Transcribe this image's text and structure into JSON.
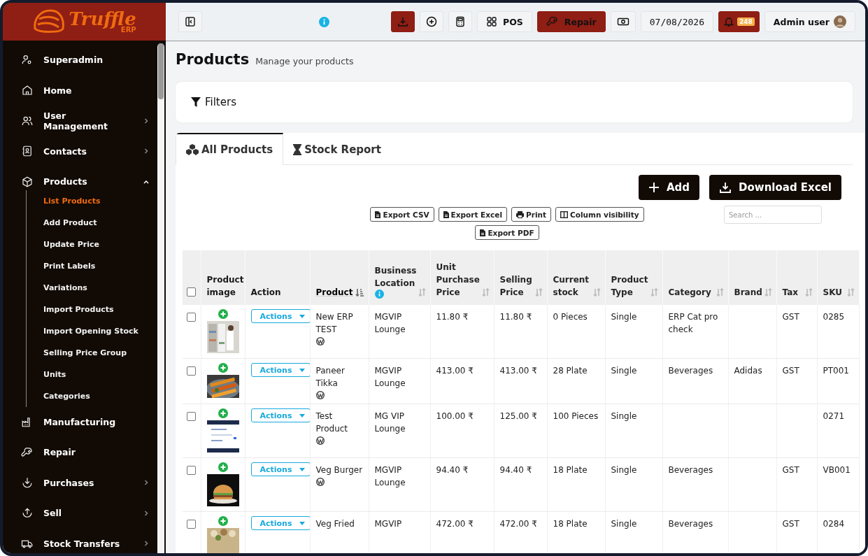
{
  "brand": {
    "name": "Truffle",
    "suffix": "ERP"
  },
  "header": {
    "pos": "POS",
    "repair": "Repair",
    "date": "07/08/2026",
    "notifications": "248",
    "user": "Admin user"
  },
  "sidebar": {
    "items": [
      {
        "label": "Superadmin",
        "expandable": false
      },
      {
        "label": "Home",
        "expandable": false
      },
      {
        "label": "User Management",
        "expandable": true,
        "expanded": false
      },
      {
        "label": "Contacts",
        "expandable": true,
        "expanded": false
      },
      {
        "label": "Products",
        "expandable": true,
        "expanded": true,
        "children": [
          {
            "label": "List Products",
            "selected": true
          },
          {
            "label": "Add Product",
            "selected": false
          },
          {
            "label": "Update Price",
            "selected": false
          },
          {
            "label": "Print Labels",
            "selected": false
          },
          {
            "label": "Variations",
            "selected": false
          },
          {
            "label": "Import Products",
            "selected": false
          },
          {
            "label": "Import Opening Stock",
            "selected": false
          },
          {
            "label": "Selling Price Group",
            "selected": false
          },
          {
            "label": "Units",
            "selected": false
          },
          {
            "label": "Categories",
            "selected": false
          }
        ]
      },
      {
        "label": "Manufacturing",
        "expandable": false
      },
      {
        "label": "Repair",
        "expandable": false
      },
      {
        "label": "Purchases",
        "expandable": true,
        "expanded": false
      },
      {
        "label": "Sell",
        "expandable": true,
        "expanded": false
      },
      {
        "label": "Stock Transfers",
        "expandable": true,
        "expanded": false
      }
    ]
  },
  "page": {
    "title": "Products",
    "subtitle": "Manage your products"
  },
  "filters": {
    "label": "Filters"
  },
  "tabs": [
    {
      "label": "All Products",
      "selected": true
    },
    {
      "label": "Stock Report",
      "selected": false
    }
  ],
  "actions": {
    "add": "Add",
    "download": "Download Excel"
  },
  "export_buttons": [
    "Export CSV",
    "Export Excel",
    "Print",
    "Column visibility",
    "Export PDF"
  ],
  "search": {
    "placeholder": "Search ..."
  },
  "table": {
    "columns": [
      {
        "kind": "check",
        "checked": false
      },
      {
        "kind": "text",
        "label": "Product image",
        "sortable": false,
        "info": false
      },
      {
        "kind": "text",
        "label": "Action",
        "sortable": false,
        "info": false
      },
      {
        "kind": "text",
        "label": "Product",
        "sortable": true,
        "sorted": true,
        "info": false
      },
      {
        "kind": "text",
        "label": "Business Location",
        "sortable": true,
        "sorted": false,
        "info": true
      },
      {
        "kind": "text",
        "label": "Unit Purchase Price",
        "sortable": true,
        "sorted": false,
        "info": false
      },
      {
        "kind": "text",
        "label": "Selling Price",
        "sortable": true,
        "sorted": false,
        "info": false
      },
      {
        "kind": "text",
        "label": "Current stock",
        "sortable": true,
        "sorted": false,
        "info": false
      },
      {
        "kind": "text",
        "label": "Product Type",
        "sortable": true,
        "sorted": false,
        "info": false
      },
      {
        "kind": "text",
        "label": "Category",
        "sortable": true,
        "sorted": false,
        "info": false
      },
      {
        "kind": "text",
        "label": "Brand",
        "sortable": true,
        "sorted": false,
        "info": false
      },
      {
        "kind": "text",
        "label": "Tax",
        "sortable": true,
        "sorted": false,
        "info": false
      },
      {
        "kind": "text",
        "label": "SKU",
        "sortable": true,
        "sorted": false,
        "info": false
      }
    ],
    "rows": [
      {
        "checked": false,
        "synced": true,
        "cells": [
          "",
          "",
          "Actions",
          "New ERP TEST",
          "MGVIP Lounge",
          "11.80 ₹",
          "11.80 ₹",
          "0 Pieces",
          "Single",
          "ERP Cat pro check",
          "",
          "GST",
          "0285"
        ]
      },
      {
        "checked": false,
        "synced": true,
        "cells": [
          "",
          "",
          "Actions",
          "Paneer Tikka",
          "MGVIP Lounge",
          "413.00 ₹",
          "413.00 ₹",
          "28 Plate",
          "Single",
          "Beverages",
          "Adidas",
          "GST",
          "PT001"
        ]
      },
      {
        "checked": false,
        "synced": true,
        "cells": [
          "",
          "",
          "Actions",
          "Test Product",
          "MG VIP Lounge",
          "100.00 ₹",
          "125.00 ₹",
          "100 Pieces",
          "Single",
          "",
          "",
          "",
          "0271"
        ]
      },
      {
        "checked": false,
        "synced": true,
        "cells": [
          "",
          "",
          "Actions",
          "Veg Burger",
          "MGVIP Lounge",
          "94.40 ₹",
          "94.40 ₹",
          "18 Plate",
          "Single",
          "Beverages",
          "",
          "GST",
          "VB001"
        ]
      },
      {
        "checked": false,
        "synced": false,
        "cells": [
          "",
          "",
          "Actions",
          "Veg Fried",
          "MGVIP",
          "472.00 ₹",
          "472.00 ₹",
          "18 Plate",
          "Single",
          "Beverages",
          "",
          "GST",
          "0284"
        ]
      }
    ]
  }
}
